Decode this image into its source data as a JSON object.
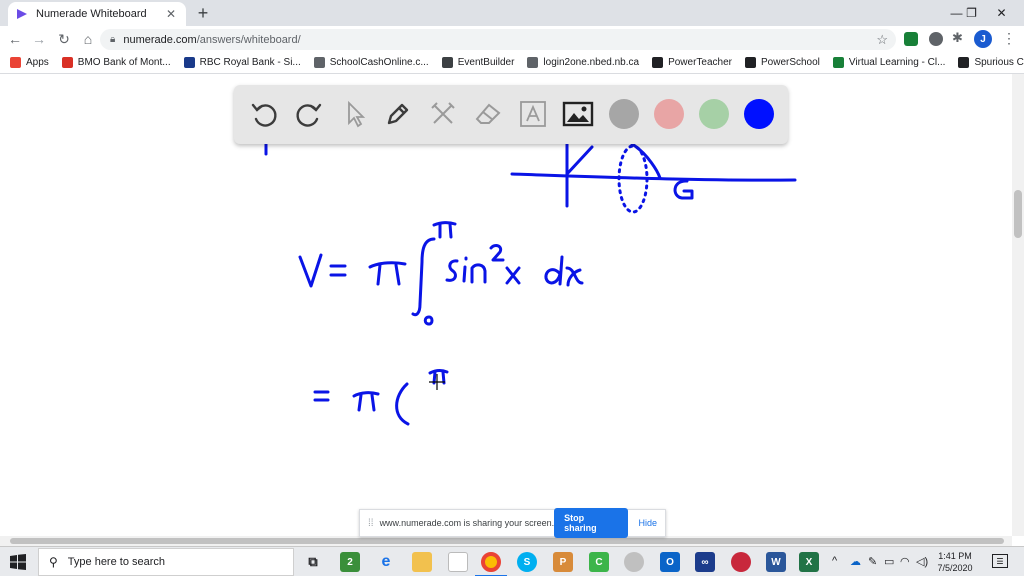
{
  "browser": {
    "tab_title": "Numerade Whiteboard",
    "tab_close": "✕",
    "new_tab": "+",
    "url_host": "numerade.com",
    "url_path": "/answers/whiteboard/",
    "profile_initial": "J"
  },
  "bookmarks": [
    {
      "label": "Apps",
      "color": "#ea4335"
    },
    {
      "label": "BMO Bank of Mont...",
      "color": "#d93025"
    },
    {
      "label": "RBC Royal Bank - Si...",
      "color": "#1a3a8a"
    },
    {
      "label": "SchoolCashOnline.c...",
      "color": "#5f6368"
    },
    {
      "label": "EventBuilder",
      "color": "#3c4043"
    },
    {
      "label": "login2one.nbed.nb.ca",
      "color": "#5f6368"
    },
    {
      "label": "PowerTeacher",
      "color": "#202124"
    },
    {
      "label": "PowerSchool",
      "color": "#202124"
    },
    {
      "label": "Virtual Learning - Cl...",
      "color": "#188038"
    },
    {
      "label": "Spurious Correlations",
      "color": "#202124"
    }
  ],
  "whiteboard": {
    "ink_color": "#0a14e6",
    "tools": [
      "undo-icon",
      "redo-icon",
      "pointer-icon",
      "pen-icon",
      "tools-icon",
      "eraser-icon",
      "text-icon",
      "image-icon"
    ],
    "swatches": [
      "#a6a6a6",
      "#e8a5a5",
      "#a6d0a6",
      "#0010ff"
    ]
  },
  "share_banner": {
    "message": "www.numerade.com is sharing your screen.",
    "stop_label": "Stop sharing",
    "hide_label": "Hide"
  },
  "taskbar": {
    "search_placeholder": "Type here to search",
    "time": "1:41 PM",
    "date": "7/5/2020"
  }
}
